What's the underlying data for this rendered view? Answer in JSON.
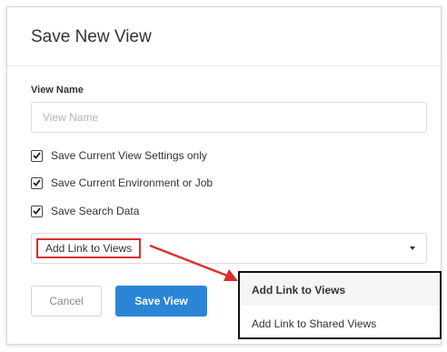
{
  "dialog": {
    "title": "Save New View"
  },
  "view_name": {
    "label": "View Name",
    "placeholder": "View Name",
    "value": ""
  },
  "options": [
    {
      "label": "Save Current View Settings only",
      "checked": true
    },
    {
      "label": "Save Current Environment or Job",
      "checked": true
    },
    {
      "label": "Save Search Data",
      "checked": true
    }
  ],
  "link_select": {
    "selected": "Add Link to Views",
    "options": [
      "Add Link to Views",
      "Add Link to Shared Views"
    ]
  },
  "buttons": {
    "cancel": "Cancel",
    "save": "Save View"
  },
  "colors": {
    "primary": "#2b85d6",
    "annotation": "#d9302e"
  }
}
